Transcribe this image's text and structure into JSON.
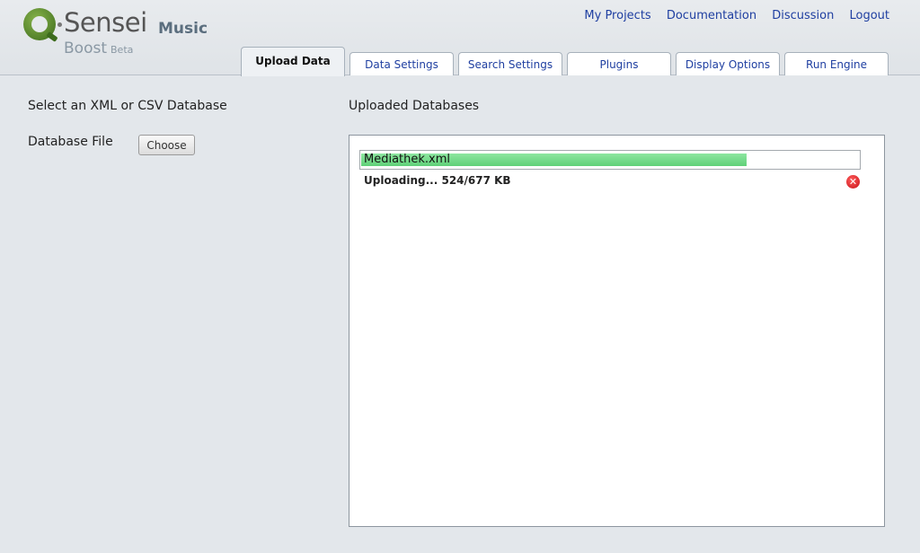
{
  "logo": {
    "name": "Q·Sensei",
    "sub": "Boost",
    "beta": "Beta"
  },
  "product": "Music",
  "toplinks": [
    "My Projects",
    "Documentation",
    "Discussion",
    "Logout"
  ],
  "tabs": [
    {
      "label": "Upload Data",
      "active": true
    },
    {
      "label": "Data Settings",
      "active": false
    },
    {
      "label": "Search Settings",
      "active": false
    },
    {
      "label": "Plugins",
      "active": false
    },
    {
      "label": "Display Options",
      "active": false
    },
    {
      "label": "Run Engine",
      "active": false
    }
  ],
  "left": {
    "title": "Select an XML or CSV Database",
    "file_label": "Database File",
    "choose_label": "Choose"
  },
  "right": {
    "title": "Uploaded Databases",
    "upload": {
      "file_name": "Mediathek.xml",
      "status": "Uploading... 524/677 KB",
      "progress": 0.774
    }
  },
  "colors": {
    "link": "#1f3fa1",
    "progress": "#5fd078",
    "cancel": "#c7141a"
  },
  "icons": {
    "cancel": "close-icon"
  }
}
